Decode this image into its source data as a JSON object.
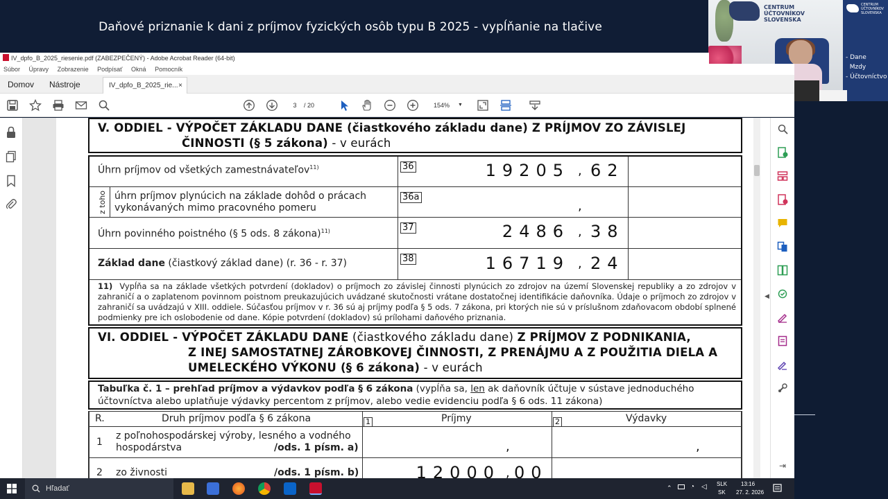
{
  "banner": {
    "title": "Daňové priznanie k dani z príjmov fyzických osôb typu B 2025 - vypĺňanie na tlačive"
  },
  "webcam": {
    "logo_text": "CENTRUM\nÚČTOVNÍKOV\nSLOVENSKA",
    "rollup_small": "CENTRUM\nÚČTOVNÍKOV\nSLOVENSKA",
    "rollup_text": "- Dane\n  Mzdy\n- Účtovníctvo"
  },
  "acrobat": {
    "window_title": "IV_dpfo_B_2025_riesenie.pdf (ZABEZPEČENÝ) - Adobe Acrobat Reader (64-bit)",
    "menu": [
      "Súbor",
      "Úpravy",
      "Zobrazenie",
      "Podpísať",
      "Okná",
      "Pomocník"
    ],
    "home_tab": "Domov",
    "tools_tab": "Nástroje",
    "doc_tab": "IV_dpfo_B_2025_rie...",
    "doc_tab_close": "×",
    "page_current": "3",
    "page_total": "/ 20",
    "zoom": "154%"
  },
  "form": {
    "sec5_title_bold": "V. ODDIEL - VÝPOČET ZÁKLADU DANE (čiastkového základu dane) Z PRÍJMOV ZO ZÁVISLEJ",
    "sec5_title_bold2": "ČINNOSTI (§ 5 zákona)",
    "sec5_title_norm": " - v eurách",
    "r36_label": "Úhrn príjmov od všetkých zamestnávateľov",
    "r36_sup": "11)",
    "r36_tag": "36",
    "r36_int": "19205",
    "r36_dec": "62",
    "ztoho": "z toho",
    "r36a_label_1": "úhrn príjmov plynúcich na základe dohôd o prácach",
    "r36a_label_2": "vykonávaných mimo pracovného pomeru",
    "r36a_tag": "36a",
    "r37_label": "Úhrn povinného poistného (§ 5 ods. 8 zákona)",
    "r37_sup": "11)",
    "r37_tag": "37",
    "r37_int": "2486",
    "r37_dec": "38",
    "r38_label_bold": "Základ dane",
    "r38_label_norm": " (čiastkový základ dane) (r. 36 - r. 37)",
    "r38_tag": "38",
    "r38_int": "16719",
    "r38_dec": "24",
    "comma": ",",
    "note_mark": "11)",
    "note_text": "Vypĺňa sa na základe všetkých potvrdení (dokladov) o príjmoch zo závislej činnosti plynúcich zo zdrojov na území Slovenskej republiky a zo zdrojov v zahraničí a o zaplatenom povinnom poistnom preukazujúcich uvádzané skutočnosti vrátane dostatočnej identifikácie daňovníka. Údaje o príjmoch zo zdrojov v zahraničí sa uvádzajú v XIII. oddiele. Súčasťou príjmov v r. 36 sú aj príjmy podľa § 5 ods. 7 zákona, pri ktorých nie sú v príslušnom zdaňovacom období splnené podmienky pre ich oslobodenie od dane. Kópie potvrdení (dokladov) sú prílohami daňového priznania.",
    "sec6_line1": "VI. ODDIEL - VÝPOČET ZÁKLADU DANE",
    "sec6_line1_norm": " (čiastkového základu dane) ",
    "sec6_line1_end": "Z PRÍJMOV Z PODNIKANIA,",
    "sec6_line2": "Z INEJ SAMOSTATNEJ ZÁROBKOVEJ ČINNOSTI, Z PRENÁJMU A Z POUŽITIA DIELA A",
    "sec6_line3": "UMELECKÉHO VÝKONU (§ 6 zákona)",
    "sec6_line3_norm": " - v eurách",
    "t1_bold": "Tabuľka č. 1 – prehľad príjmov a výdavkov podľa § 6 zákona",
    "t1_norm_a": " (vypĺňa sa, ",
    "t1_underline": "len",
    "t1_norm_b": " ak daňovník účtuje v sústave jednoduchého",
    "t1_line2": "účtovníctva alebo uplatňuje výdavky percentom z príjmov, alebo vedie evidenciu podľa § 6 ods. 11 zákona)",
    "col_r": "R.",
    "col_druh": "Druh príjmov podľa § 6 zákona",
    "col1_tag": "1",
    "col_prijmy": "Príjmy",
    "col2_tag": "2",
    "col_vydavky": "Výdavky",
    "row1_num": "1",
    "row1_label_1": "z poľnohospodárskej výroby, lesného a vodného",
    "row1_label_2": "hospodárstva",
    "row1_ods": "/ods. 1 písm. a)",
    "row2_num": "2",
    "row2_label": "zo živnosti",
    "row2_ods": "/ods. 1 písm. b)",
    "row2_int": "12000",
    "row2_dec": "00"
  },
  "taskbar": {
    "search_placeholder": "Hľadať",
    "lang_1": "SLK",
    "lang_2": "SK",
    "time": "13:16",
    "date": "27. 2. 2026"
  }
}
